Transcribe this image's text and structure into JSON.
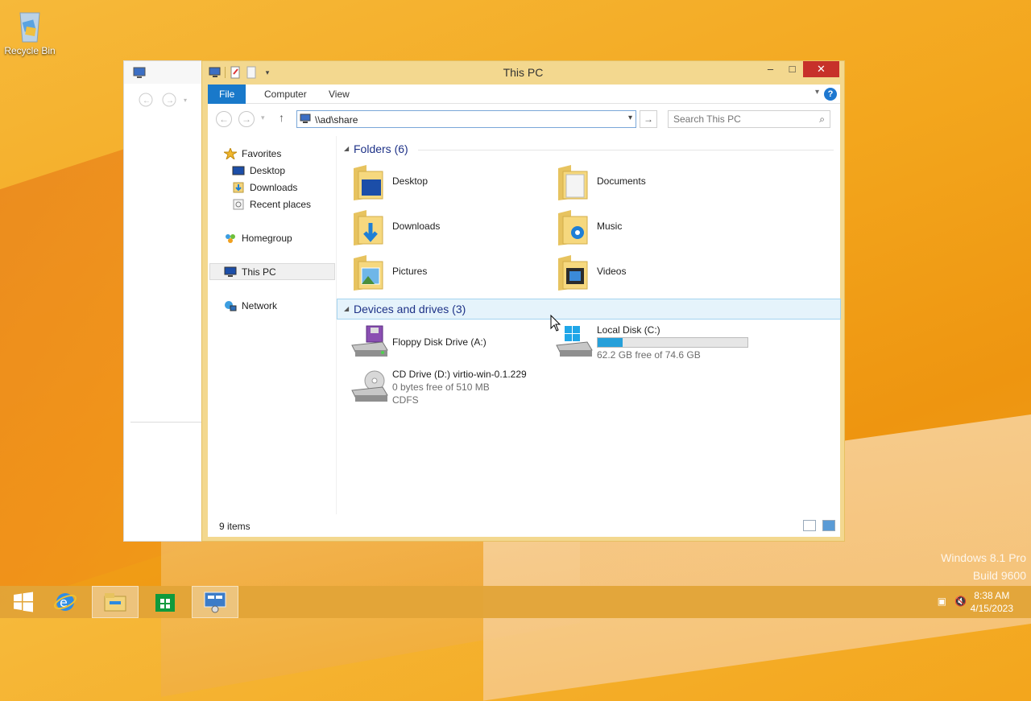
{
  "desktop": {
    "recycle_bin_label": "Recycle Bin",
    "watermark_line1": "Windows 8.1 Pro",
    "watermark_line2": "Build 9600"
  },
  "window": {
    "title": "This PC",
    "ribbon_tabs": [
      "File",
      "Computer",
      "View"
    ],
    "address": "\\\\ad\\share",
    "search_placeholder": "Search This PC"
  },
  "nav": {
    "favorites": "Favorites",
    "favorites_items": [
      "Desktop",
      "Downloads",
      "Recent places"
    ],
    "homegroup": "Homegroup",
    "this_pc": "This PC",
    "network": "Network"
  },
  "folders": {
    "header": "Folders (6)",
    "items": [
      "Desktop",
      "Documents",
      "Downloads",
      "Music",
      "Pictures",
      "Videos"
    ]
  },
  "devices": {
    "header": "Devices and drives (3)",
    "floppy": "Floppy Disk Drive (A:)",
    "local_disk": {
      "name": "Local Disk (C:)",
      "free_text": "62.2 GB free of 74.6 GB",
      "used_fraction": 0.166
    },
    "cd": {
      "name": "CD Drive (D:) virtio-win-0.1.229",
      "free_text": "0 bytes free of 510 MB",
      "fs": "CDFS"
    }
  },
  "status": {
    "items_count": "9 items"
  },
  "taskbar": {
    "time": "8:38 AM",
    "date": "4/15/2023"
  },
  "colors": {
    "accent": "#1979ca",
    "desktop": "#f3a61d",
    "close": "#c7312a",
    "progress": "#26a0da"
  }
}
